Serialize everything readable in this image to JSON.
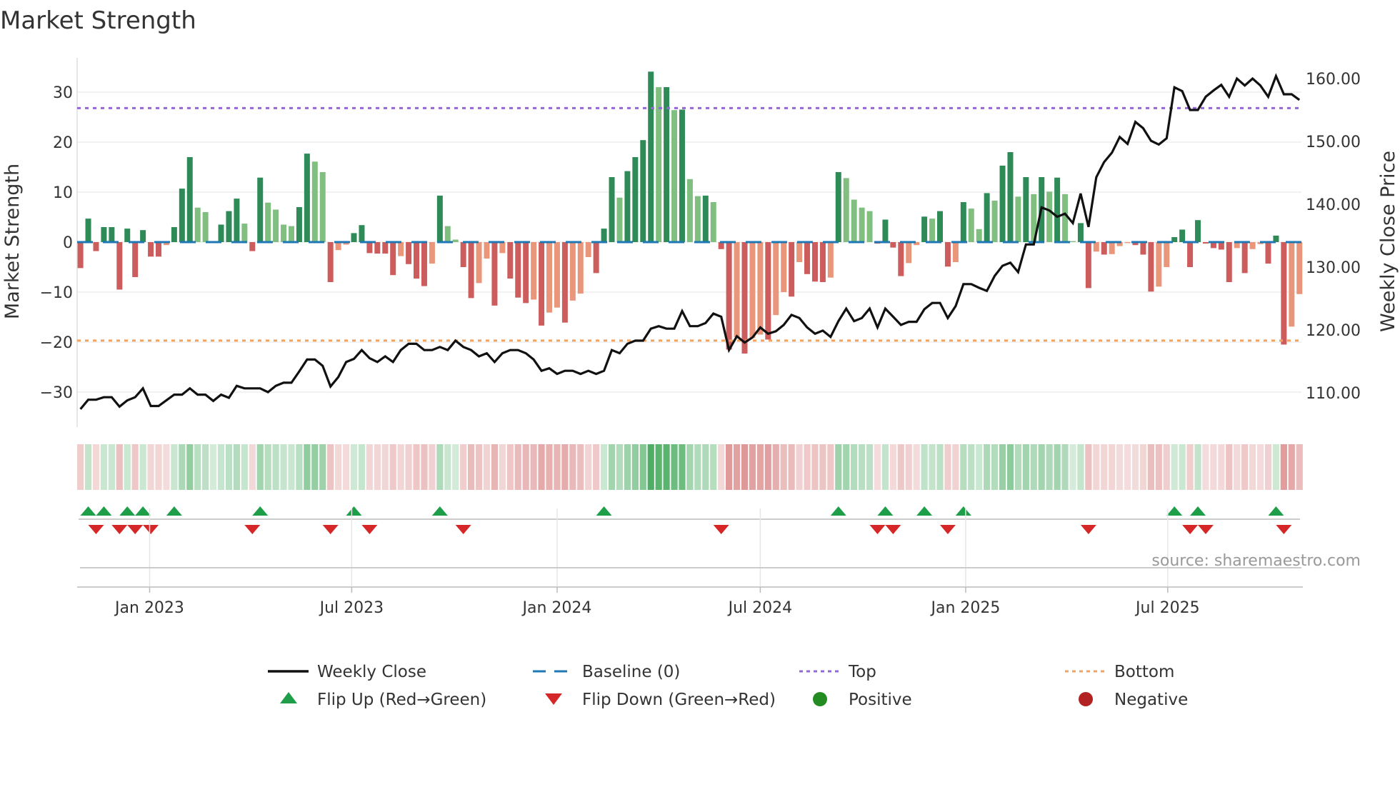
{
  "chart_data": {
    "type": "bar+line",
    "title": "Market Strength",
    "ylabel_left": "Market Strength",
    "ylabel_right": "Weekly Close Price",
    "source": "source: sharemaestro.com",
    "frequency": "weekly",
    "start_week": "2022-10-31",
    "left_axis": {
      "ylim": [
        -35,
        37
      ],
      "ticks": [
        30,
        20,
        10,
        0,
        -10,
        -20,
        -30
      ],
      "tick_labels": [
        "30",
        "20",
        "10",
        "0",
        "−10",
        "−20",
        "−30"
      ]
    },
    "right_axis": {
      "ylim": [
        105,
        163
      ],
      "ticks": [
        160,
        150,
        140,
        130,
        120,
        110
      ],
      "tick_labels": [
        "160.00",
        "150.00",
        "140.00",
        "130.00",
        "120.00",
        "110.00"
      ]
    },
    "x_ticks": [
      {
        "date": "2023-01-01",
        "label": "Jan 2023"
      },
      {
        "date": "2023-07-01",
        "label": "Jul 2023"
      },
      {
        "date": "2024-01-01",
        "label": "Jan 2024"
      },
      {
        "date": "2024-07-01",
        "label": "Jul 2024"
      },
      {
        "date": "2025-01-01",
        "label": "Jan 2025"
      },
      {
        "date": "2025-07-01",
        "label": "Jul 2025"
      }
    ],
    "top_level": 26.8,
    "bottom_level": -19.7,
    "baseline": 0,
    "strength": [
      -5.2,
      4.7,
      -1.8,
      3.0,
      3.0,
      -9.5,
      2.7,
      -7.0,
      2.4,
      -2.9,
      -2.9,
      -0.6,
      3.0,
      10.7,
      17.0,
      6.9,
      6.0,
      0.2,
      3.5,
      6.2,
      8.7,
      3.7,
      -1.8,
      12.9,
      7.9,
      6.5,
      3.5,
      3.2,
      7.0,
      17.7,
      16.1,
      14.0,
      -8.0,
      -1.6,
      -0.5,
      1.8,
      3.4,
      -2.2,
      -2.3,
      -2.3,
      -6.6,
      -2.8,
      -4.4,
      -7.3,
      -8.8,
      -4.3,
      9.3,
      3.2,
      0.5,
      -5.0,
      -11.2,
      -8.2,
      -3.3,
      -12.7,
      -2.2,
      -7.3,
      -11.1,
      -12.2,
      -11.5,
      -16.7,
      -14.1,
      -13.1,
      -16.1,
      -11.7,
      -10.3,
      -3.0,
      -6.2,
      2.7,
      13.0,
      8.9,
      14.2,
      17.0,
      20.4,
      34.1,
      31.0,
      31.0,
      26.4,
      26.5,
      12.6,
      9.2,
      9.3,
      8.0,
      -1.4,
      -21.5,
      -19.0,
      -22.3,
      -19.2,
      -18.5,
      -19.5,
      -14.6,
      -10.0,
      -10.9,
      -4.0,
      -6.4,
      -7.9,
      -8.0,
      -7.1,
      14.0,
      12.8,
      8.5,
      6.9,
      6.2,
      -0.3,
      4.5,
      -1.1,
      -6.8,
      -4.2,
      -0.6,
      5.1,
      4.7,
      6.2,
      -4.9,
      -4.0,
      8.0,
      6.7,
      2.6,
      9.8,
      8.3,
      15.3,
      18.0,
      9.1,
      13.0,
      9.6,
      13.0,
      10.1,
      12.9,
      9.6,
      0.2,
      3.8,
      -9.2,
      -1.9,
      -2.5,
      -2.4,
      -0.8,
      -0.2,
      -0.6,
      -2.5,
      -9.9,
      -8.9,
      -5.0,
      1.0,
      2.5,
      -5.0,
      4.4,
      -0.3,
      -1.2,
      -1.5,
      -8.0,
      -1.2,
      -6.2,
      -1.4,
      -0.4,
      -4.3,
      1.3,
      -20.5,
      -16.9,
      -10.4
    ],
    "weekly_close": [
      107.4,
      108.9,
      108.9,
      109.3,
      109.3,
      107.8,
      108.8,
      109.3,
      110.7,
      107.9,
      107.9,
      108.8,
      109.7,
      109.7,
      110.7,
      109.7,
      109.7,
      108.7,
      109.7,
      109.2,
      111.1,
      110.7,
      110.7,
      110.7,
      110.1,
      111.1,
      111.6,
      111.6,
      113.4,
      115.3,
      115.3,
      114.3,
      111.0,
      112.5,
      114.9,
      115.4,
      116.8,
      115.5,
      114.9,
      115.8,
      114.9,
      116.8,
      117.8,
      117.8,
      116.8,
      116.8,
      117.3,
      116.8,
      118.3,
      117.3,
      116.8,
      115.8,
      116.3,
      114.9,
      116.3,
      116.8,
      116.8,
      116.3,
      115.3,
      113.5,
      113.9,
      113.0,
      113.5,
      113.5,
      113.0,
      113.5,
      113.0,
      113.5,
      116.8,
      116.3,
      117.8,
      118.3,
      118.3,
      120.2,
      120.6,
      120.2,
      120.2,
      123.0,
      120.6,
      120.6,
      121.1,
      122.6,
      122.1,
      116.8,
      119.0,
      118.0,
      118.8,
      120.4,
      119.4,
      119.8,
      120.8,
      122.4,
      121.9,
      120.4,
      119.4,
      119.9,
      118.9,
      121.4,
      123.4,
      121.4,
      121.9,
      123.4,
      120.4,
      123.4,
      122.1,
      120.8,
      121.3,
      121.3,
      123.3,
      124.3,
      124.3,
      121.9,
      123.8,
      127.3,
      127.3,
      126.7,
      126.2,
      128.6,
      130.2,
      130.7,
      129.2,
      133.6,
      133.6,
      139.5,
      139.0,
      138.0,
      138.5,
      137.0,
      141.7,
      136.4,
      144.3,
      146.7,
      148.2,
      150.7,
      149.6,
      153.1,
      152.1,
      150.1,
      149.5,
      150.5,
      158.6,
      158.0,
      155.0,
      155.0,
      157.1,
      158.1,
      159.0,
      157.1,
      160.0,
      158.9,
      160.0,
      158.9,
      157.1,
      160.4,
      157.5,
      157.5,
      156.6
    ],
    "flip_up_weeks": [
      1,
      3,
      6,
      8,
      12,
      23,
      35,
      46,
      67,
      97,
      103,
      108,
      113,
      140,
      143,
      153
    ],
    "flip_down_weeks": [
      2,
      5,
      7,
      9,
      22,
      32,
      37,
      49,
      82,
      102,
      104,
      111,
      129,
      142,
      144,
      154
    ],
    "legend": [
      {
        "label": "Weekly Close",
        "kind": "line"
      },
      {
        "label": "Baseline (0)",
        "kind": "dash"
      },
      {
        "label": "Top",
        "kind": "dot-top"
      },
      {
        "label": "Bottom",
        "kind": "dot-bottom"
      },
      {
        "label": "Flip Up (Red→Green)",
        "kind": "up"
      },
      {
        "label": "Flip Down (Green→Red)",
        "kind": "down"
      },
      {
        "label": "Positive",
        "kind": "pos"
      },
      {
        "label": "Negative",
        "kind": "neg"
      }
    ],
    "legend_placement": "bottom",
    "colors": {
      "pos_strong": "#2e8b57",
      "pos_weak": "#80bf80",
      "neg_strong": "#cd5c5c",
      "neg_weak": "#e9967a",
      "line": "#111111",
      "baseline": "#1f77b4",
      "top": "#9467dc",
      "bottom": "#f4a460",
      "flip_up": "#1f9e49",
      "flip_down": "#d62728",
      "positive": "#228b22",
      "negative": "#b22222"
    }
  }
}
